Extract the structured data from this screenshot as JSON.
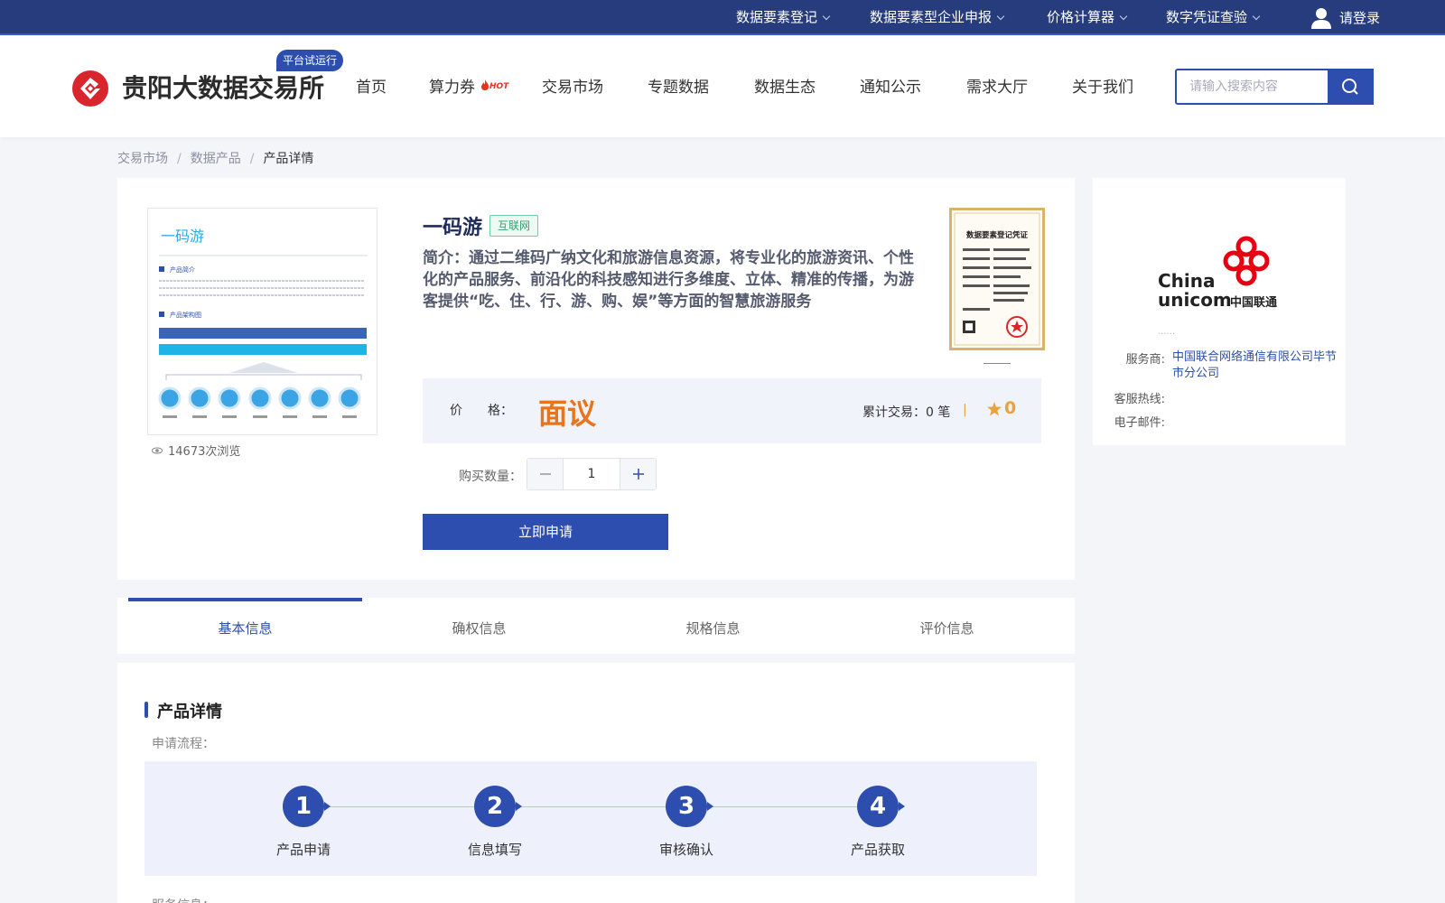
{
  "topbar": {
    "items": [
      {
        "label": "数据要素登记"
      },
      {
        "label": "数据要素型企业申报"
      },
      {
        "label": "价格计算器"
      },
      {
        "label": "数字凭证查验"
      }
    ],
    "login_label": "请登录"
  },
  "header": {
    "logo_text": "贵阳大数据交易所",
    "trial_badge": "平台试运行",
    "nav": [
      {
        "label": "首页"
      },
      {
        "label": "算力券"
      },
      {
        "label": "交易市场"
      },
      {
        "label": "专题数据"
      },
      {
        "label": "数据生态"
      },
      {
        "label": "通知公示"
      },
      {
        "label": "需求大厅"
      },
      {
        "label": "关于我们"
      }
    ],
    "hot_label": "HOT",
    "search_placeholder": "请输入搜索内容"
  },
  "breadcrumb": {
    "items": [
      "交易市场",
      "数据产品",
      "产品详情"
    ],
    "separator": "/"
  },
  "product": {
    "image_title": "一码游",
    "image_section1": "产品简介",
    "image_section2": "产品架构图",
    "views": "14673次浏览",
    "title": "一码游",
    "tag": "互联网",
    "description": "简介：通过二维码广纳文化和旅游信息资源，将专业化的旅游资讯、个性化的产品服务、前沿化的科技感知进行多维度、立体、精准的传播，为游客提供“吃、住、行、游、购、娱”等方面的智慧旅游服务",
    "cert_title": "数据要素登记凭证",
    "price_label": "价　　格：",
    "price_value": "面议",
    "trades_label": "累计交易：",
    "trades_value": "0 笔",
    "trades_sep": "|",
    "rating": "0",
    "qty_label": "购买数量：",
    "qty_value": "1",
    "apply_label": "立即申请"
  },
  "provider": {
    "logo_text_1": "China",
    "logo_text_2": "unicom",
    "logo_text_cn": "中国联通",
    "dots": "......",
    "service_key": "服务商:",
    "service_value": "中国联合网络通信有限公司毕节市分公司",
    "hotline_key": "客服热线:",
    "hotline_value": "",
    "email_key": "电子邮件:",
    "email_value": ""
  },
  "tabs": [
    {
      "label": "基本信息",
      "active": true
    },
    {
      "label": "确权信息",
      "active": false
    },
    {
      "label": "规格信息",
      "active": false
    },
    {
      "label": "评价信息",
      "active": false
    }
  ],
  "details": {
    "section_title": "产品详情",
    "flow_label": "申请流程：",
    "steps": [
      {
        "num": "1",
        "label": "产品申请"
      },
      {
        "num": "2",
        "label": "信息填写"
      },
      {
        "num": "3",
        "label": "审核确认"
      },
      {
        "num": "4",
        "label": "产品获取"
      }
    ],
    "service_label": "服务信息："
  },
  "colors": {
    "topbar": "#263c7d",
    "primary": "#2d4eae",
    "price": "#e8741c",
    "rating": "#e8a33c",
    "logo_red": "#d9262c"
  }
}
